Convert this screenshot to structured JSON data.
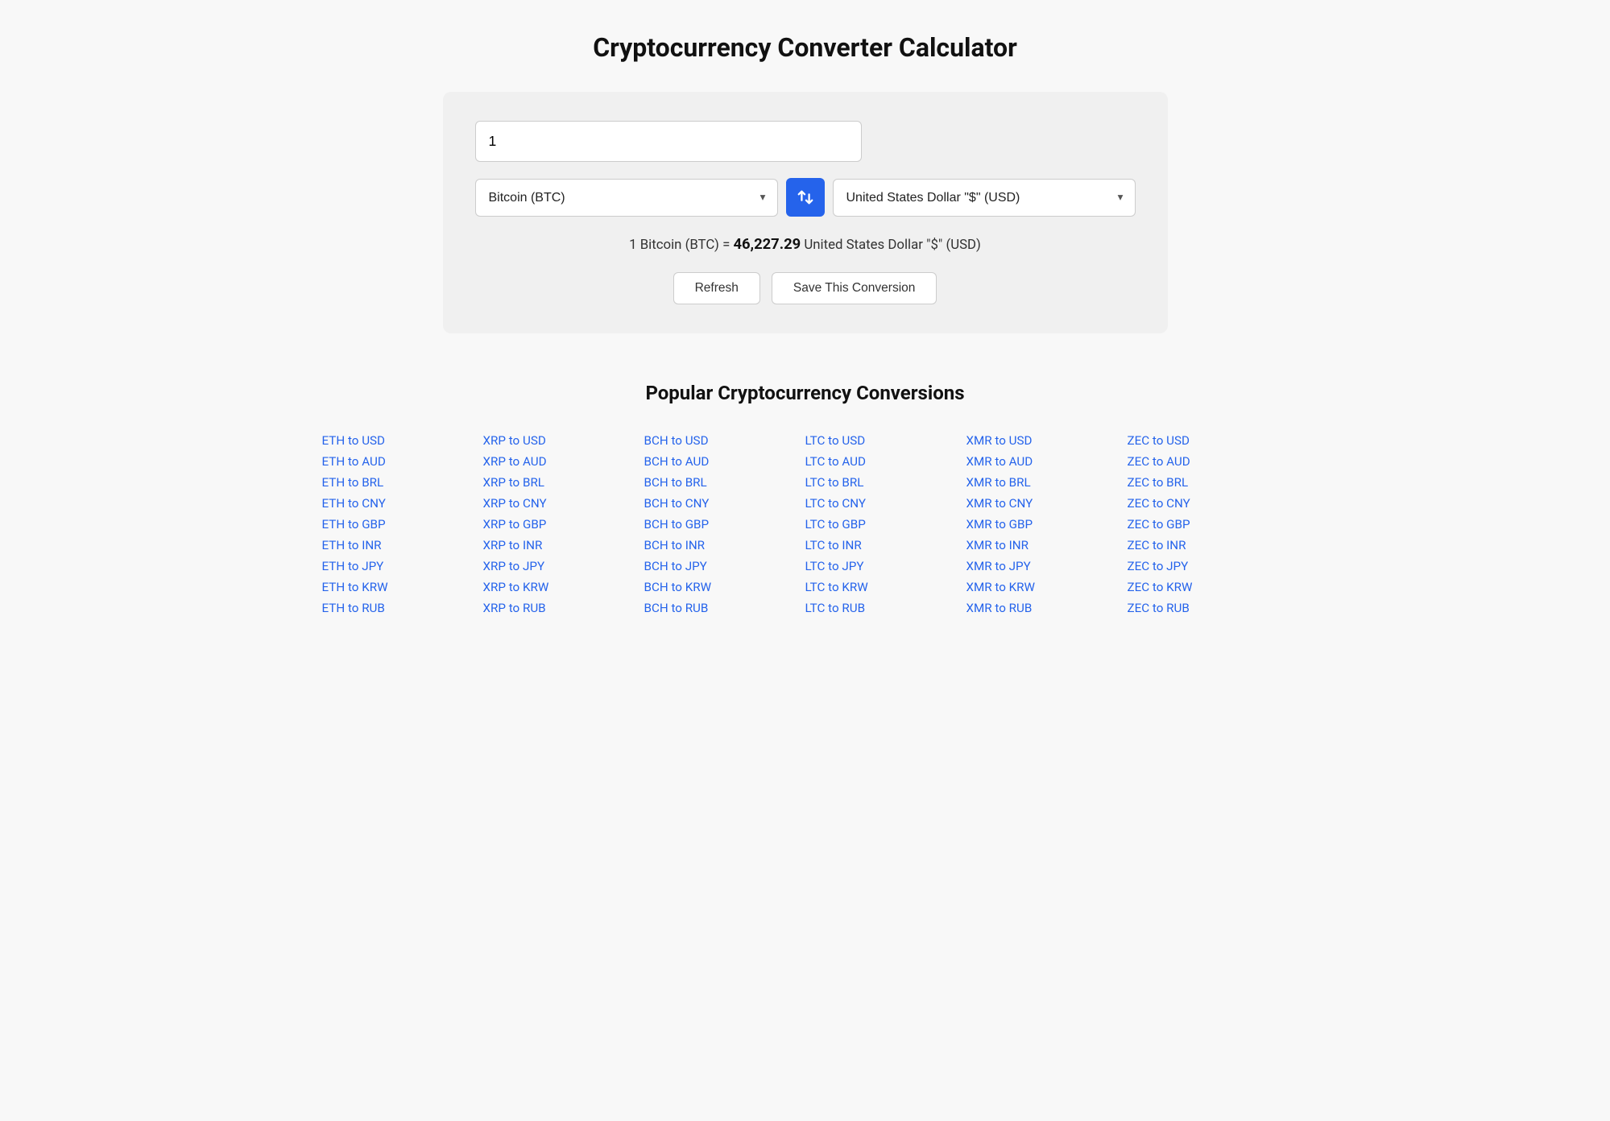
{
  "header": {
    "title": "Cryptocurrency Converter Calculator"
  },
  "converter": {
    "amount_value": "1",
    "amount_placeholder": "",
    "from_currency": "Bitcoin (BTC)",
    "to_currency": "United States Dollar \"$\" (USD)",
    "result_label": "1 Bitcoin (BTC)",
    "result_equals": "=",
    "result_value": "46,227.29",
    "result_unit": "United States Dollar \"$\" (USD)",
    "refresh_label": "Refresh",
    "save_label": "Save This Conversion",
    "swap_label": "⇄"
  },
  "popular_section": {
    "title": "Popular Cryptocurrency Conversions"
  },
  "conversions": {
    "columns": [
      {
        "id": "eth",
        "links": [
          "ETH to USD",
          "ETH to AUD",
          "ETH to BRL",
          "ETH to CNY",
          "ETH to GBP",
          "ETH to INR",
          "ETH to JPY",
          "ETH to KRW",
          "ETH to RUB"
        ]
      },
      {
        "id": "xrp",
        "links": [
          "XRP to USD",
          "XRP to AUD",
          "XRP to BRL",
          "XRP to CNY",
          "XRP to GBP",
          "XRP to INR",
          "XRP to JPY",
          "XRP to KRW",
          "XRP to RUB"
        ]
      },
      {
        "id": "bch",
        "links": [
          "BCH to USD",
          "BCH to AUD",
          "BCH to BRL",
          "BCH to CNY",
          "BCH to GBP",
          "BCH to INR",
          "BCH to JPY",
          "BCH to KRW",
          "BCH to RUB"
        ]
      },
      {
        "id": "ltc",
        "links": [
          "LTC to USD",
          "LTC to AUD",
          "LTC to BRL",
          "LTC to CNY",
          "LTC to GBP",
          "LTC to INR",
          "LTC to JPY",
          "LTC to KRW",
          "LTC to RUB"
        ]
      },
      {
        "id": "xmr",
        "links": [
          "XMR to USD",
          "XMR to AUD",
          "XMR to BRL",
          "XMR to CNY",
          "XMR to GBP",
          "XMR to INR",
          "XMR to JPY",
          "XMR to KRW",
          "XMR to RUB"
        ]
      },
      {
        "id": "zec",
        "links": [
          "ZEC to USD",
          "ZEC to AUD",
          "ZEC to BRL",
          "ZEC to CNY",
          "ZEC to GBP",
          "ZEC to INR",
          "ZEC to JPY",
          "ZEC to KRW",
          "ZEC to RUB"
        ]
      }
    ]
  }
}
